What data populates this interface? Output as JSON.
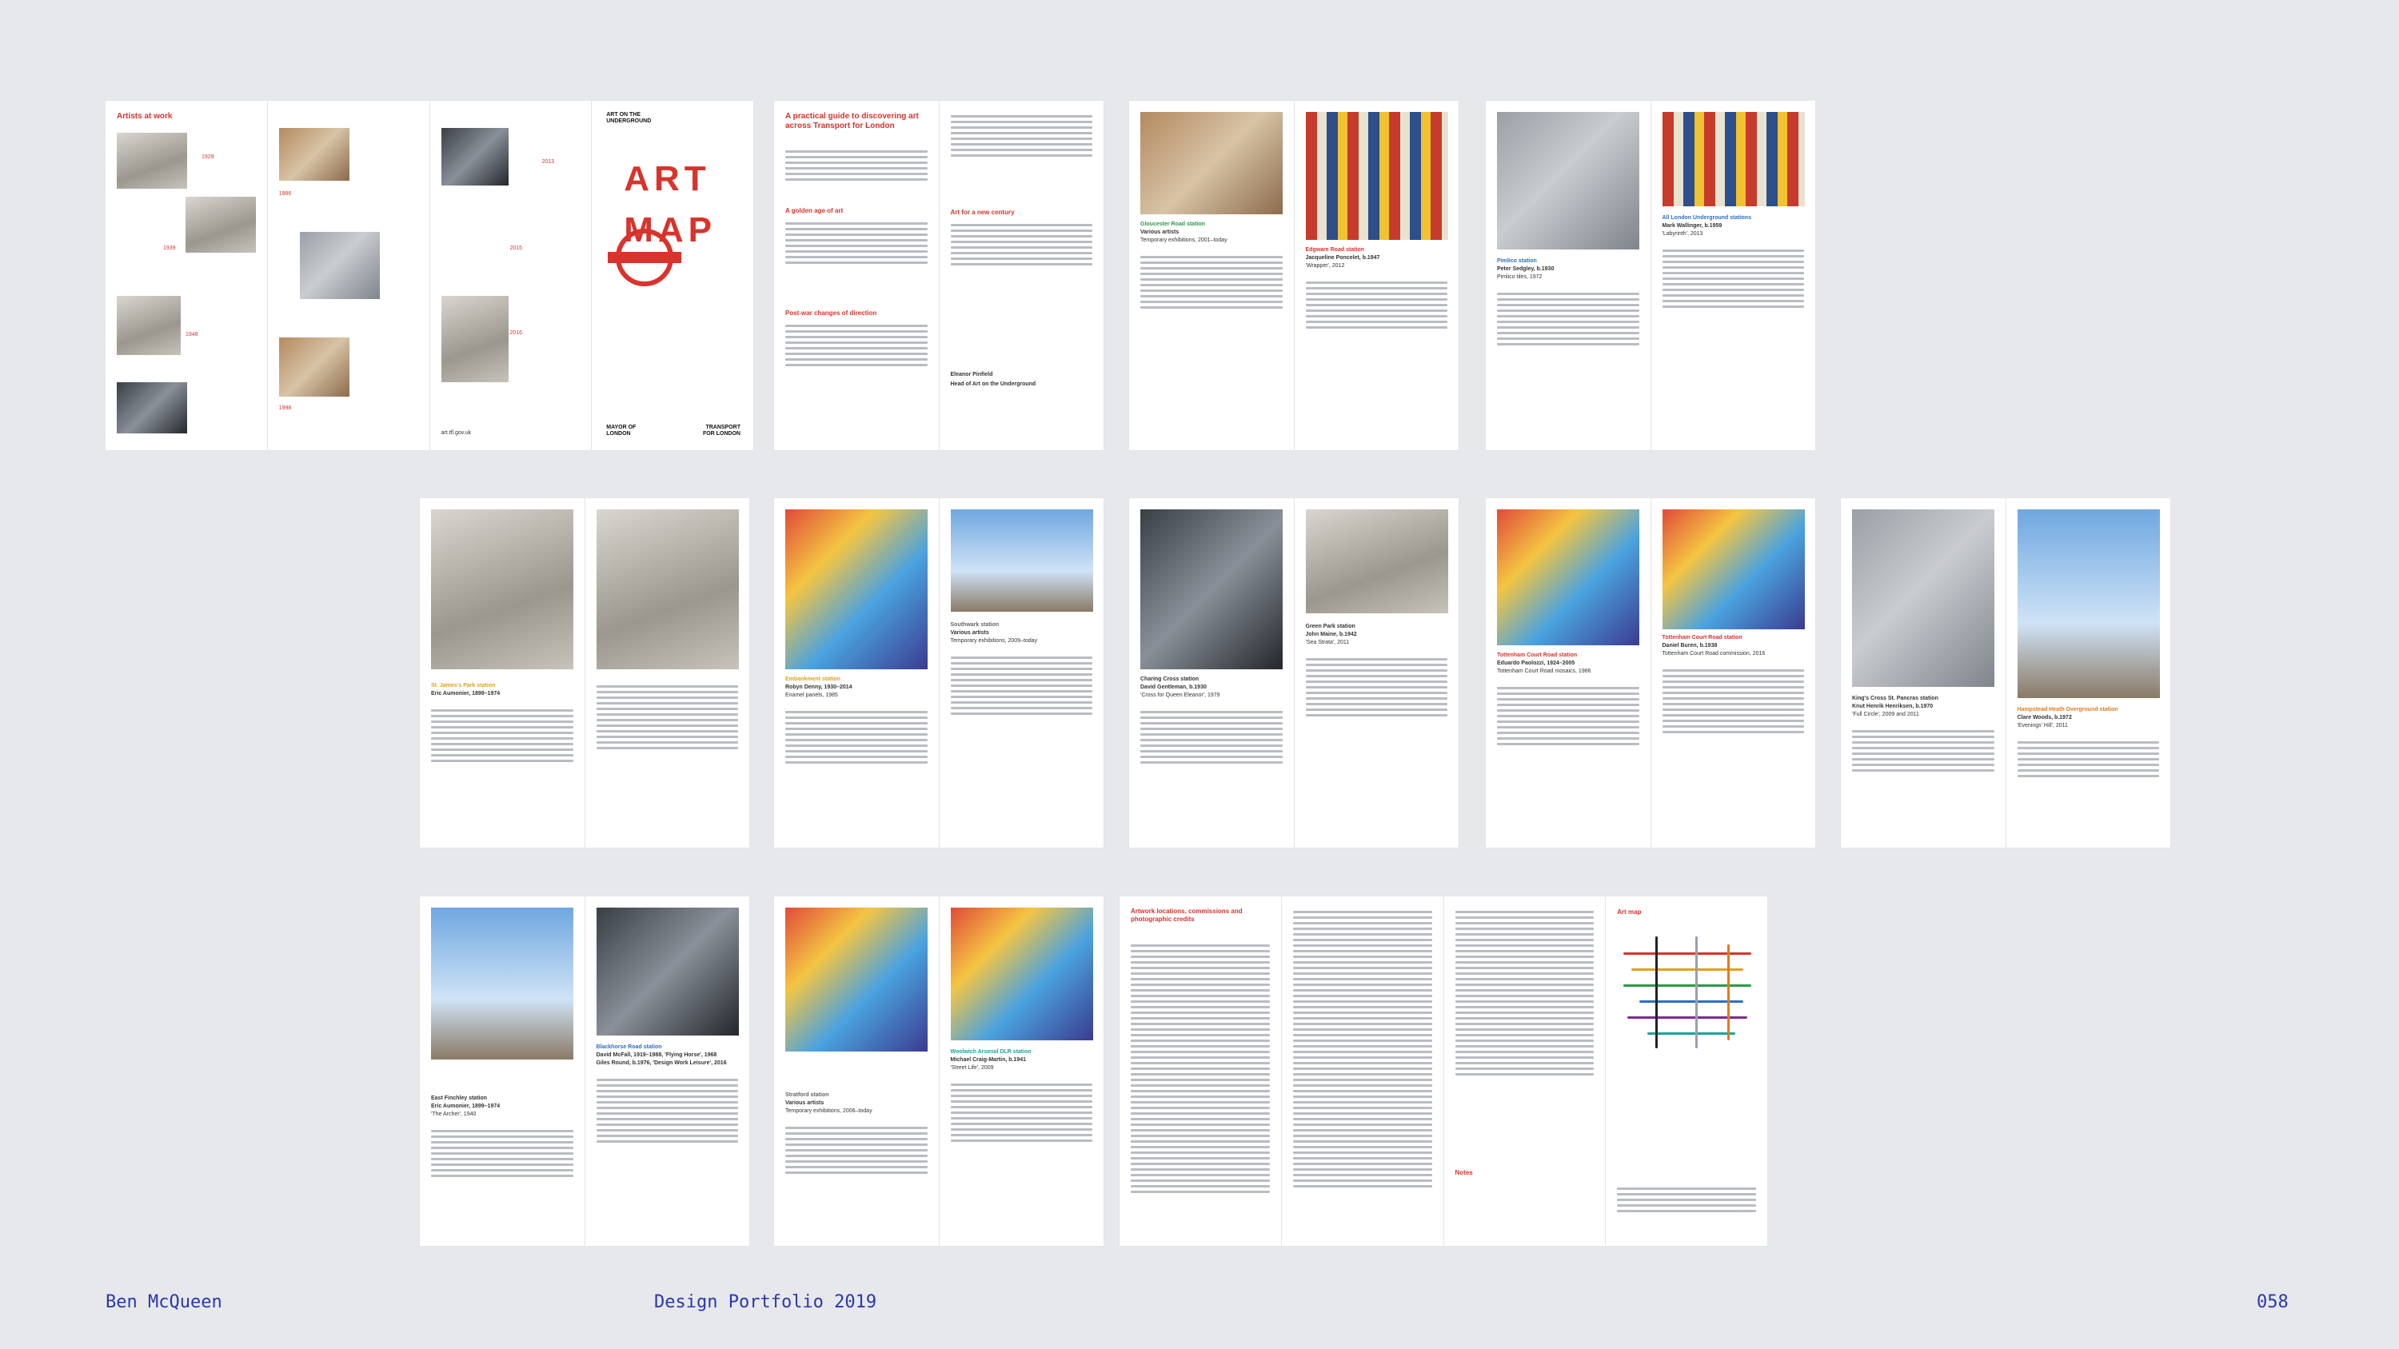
{
  "footer": {
    "author": "Ben McQueen",
    "title": "Design Portfolio 2019",
    "page_number": "058"
  },
  "spreads": {
    "artists": {
      "heading": "Artists at work",
      "years": [
        "1929",
        "1939",
        "1948",
        "1986",
        "1998",
        "2011",
        "2013",
        "2015",
        "2016"
      ]
    },
    "cover": {
      "series": "ART ON THE UNDERGROUND",
      "title_line1": "ART",
      "title_line2": "MAP",
      "mayor": "MAYOR OF LONDON",
      "tfl": "TRANSPORT FOR LONDON",
      "website": "art.tfl.gov.uk"
    },
    "guide": {
      "heading": "A practical guide to discovering art across Transport for London",
      "sub1": "A golden age of art",
      "sub2": "Post-war changes of direction",
      "sub3": "Art for a new century",
      "sign1": "Eleanor Pinfield",
      "sign2": "Head of Art on the Underground"
    },
    "gloucester": {
      "station": "Gloucester Road station",
      "artist": "Various artists",
      "dates": "Temporary exhibitions, 2001–today",
      "station2": "Edgware Road station",
      "artist2": "Jacqueline Poncelet, b.1947",
      "work2": "'Wrapper', 2012"
    },
    "pimlico": {
      "station": "Pimlico station",
      "artist": "Peter Sedgley, b.1930",
      "work": "Pimlico tiles, 1972",
      "station2": "All London Underground stations",
      "artist2": "Mark Wallinger, b.1959",
      "work2": "'Labyrinth', 2013"
    },
    "stjames": {
      "station": "St. James's Park station",
      "artist": "Eric Aumonier, 1899–1974"
    },
    "embankment": {
      "station": "Embankment station",
      "artist": "Robyn Denny, 1930–2014",
      "work": "Enamel panels, 1985",
      "station2": "Southwark station",
      "artist2": "Various artists",
      "dates2": "Temporary exhibitions, 2009–today"
    },
    "charing": {
      "station": "Charing Cross station",
      "artist": "David Gentleman, b.1930",
      "work": "'Cross for Queen Eleanor', 1979",
      "station2": "Green Park station",
      "artist2": "John Maine, b.1942",
      "work2": "'Sea Strata', 2011"
    },
    "tottenham": {
      "station": "Tottenham Court Road station",
      "artist": "Eduardo Paolozzi, 1924–2005",
      "work": "Tottenham Court Road mosaics, 1986",
      "station2": "Tottenham Court Road station",
      "artist2": "Daniel Buren, b.1938",
      "work2": "Tottenham Court Road commission, 2016"
    },
    "kingscross": {
      "station": "King's Cross St. Pancras station",
      "artist": "Knut Henrik Henriksen, b.1970",
      "work": "'Full Circle', 2009 and 2011",
      "station2": "Hampstead Heath Overground station",
      "artist2": "Clare Woods, b.1972",
      "work2": "'Evenings' Hill', 2011"
    },
    "finchley": {
      "station": "East Finchley station",
      "artist": "Eric Aumonier, 1899–1974",
      "work": "'The Archer', 1940",
      "station2": "Blackhorse Road station",
      "artist2": "David McFall, 1919–1988, 'Flying Horse', 1968",
      "artist3": "Giles Round, b.1976, 'Design Work Leisure', 2016"
    },
    "stratford": {
      "station": "Stratford station",
      "artist": "Various artists",
      "dates": "Temporary exhibitions, 2006–today",
      "station2": "Woolwich Arsenal DLR station",
      "artist2": "Michael Craig-Martin, b.1941",
      "work2": "'Street Life', 2009"
    },
    "locations": {
      "heading": "Artwork locations, commissions and photographic credits",
      "notes": "Notes",
      "map_heading": "Art map"
    }
  }
}
